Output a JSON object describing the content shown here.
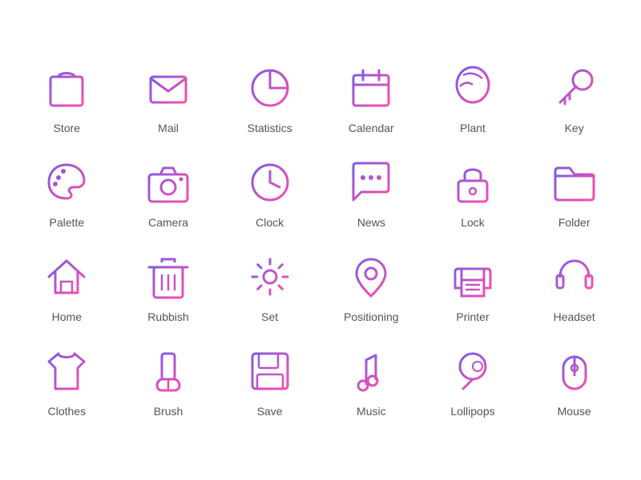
{
  "icons": [
    {
      "name": "store",
      "label": "Store"
    },
    {
      "name": "mail",
      "label": "Mail"
    },
    {
      "name": "statistics",
      "label": "Statistics"
    },
    {
      "name": "calendar",
      "label": "Calendar"
    },
    {
      "name": "plant",
      "label": "Plant"
    },
    {
      "name": "key",
      "label": "Key"
    },
    {
      "name": "palette",
      "label": "Palette"
    },
    {
      "name": "camera",
      "label": "Camera"
    },
    {
      "name": "clock",
      "label": "Clock"
    },
    {
      "name": "news",
      "label": "News"
    },
    {
      "name": "lock",
      "label": "Lock"
    },
    {
      "name": "folder",
      "label": "Folder"
    },
    {
      "name": "home",
      "label": "Home"
    },
    {
      "name": "rubbish",
      "label": "Rubbish"
    },
    {
      "name": "set",
      "label": "Set"
    },
    {
      "name": "positioning",
      "label": "Positioning"
    },
    {
      "name": "printer",
      "label": "Printer"
    },
    {
      "name": "headset",
      "label": "Headset"
    },
    {
      "name": "clothes",
      "label": "Clothes"
    },
    {
      "name": "brush",
      "label": "Brush"
    },
    {
      "name": "save",
      "label": "Save"
    },
    {
      "name": "music",
      "label": "Music"
    },
    {
      "name": "lollipops",
      "label": "Lollipops"
    },
    {
      "name": "mouse",
      "label": "Mouse"
    }
  ]
}
